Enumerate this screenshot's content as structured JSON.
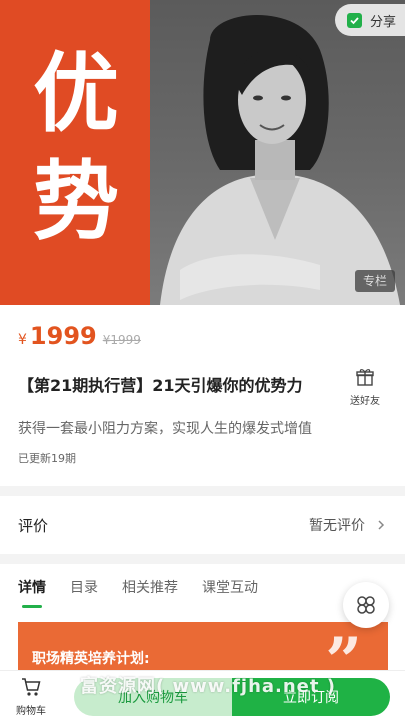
{
  "hero": {
    "char1": "优",
    "char2": "势",
    "share_label": "分享",
    "column_tag": "专栏"
  },
  "price": {
    "symbol": "¥",
    "value": "1999",
    "original": "¥1999"
  },
  "course": {
    "title": "【第21期执行营】21天引爆你的优势力",
    "subtitle": "获得一套最小阻力方案，实现人生的爆发式增值",
    "updated": "已更新19期"
  },
  "gift": {
    "label": "送好友"
  },
  "review": {
    "title": "评价",
    "status": "暂无评价"
  },
  "tabs": [
    {
      "label": "详情",
      "active": true
    },
    {
      "label": "目录",
      "active": false
    },
    {
      "label": "相关推荐",
      "active": false
    },
    {
      "label": "课堂互动",
      "active": false
    }
  ],
  "banner": {
    "text": "职场精英培养计划:",
    "quote": "”"
  },
  "bottom": {
    "cart_label": "购物车",
    "add_cart": "加入购物车",
    "buy_now": "立即订阅"
  },
  "watermark": "富资源网( www.fjha.net )",
  "colors": {
    "accent_green": "#1fb245",
    "price_orange": "#e2541f",
    "hero_orange": "#e04b24"
  },
  "icons": {
    "share": "share-icon",
    "gift": "gift-icon",
    "chevron": "chevron-right-icon",
    "float": "grid-menu-icon",
    "cart": "cart-icon"
  }
}
